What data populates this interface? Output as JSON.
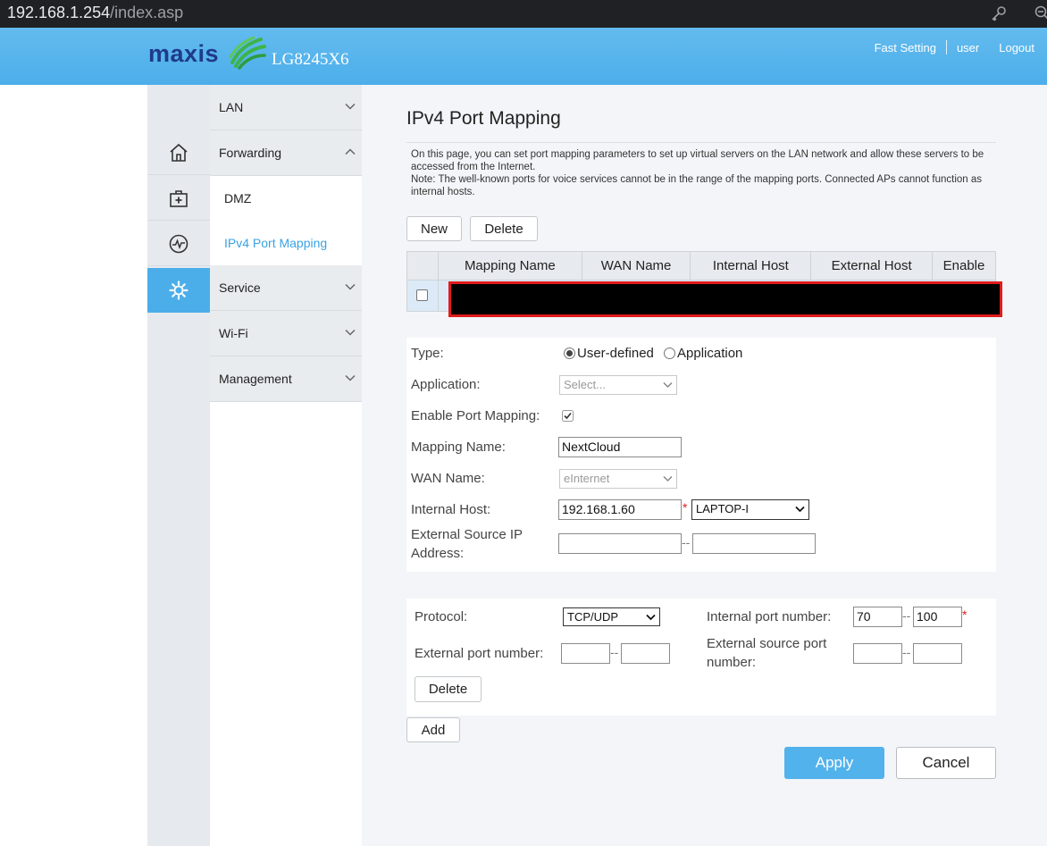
{
  "browser": {
    "url_host": "192.168.1.254",
    "url_path": "/index.asp"
  },
  "header": {
    "logo": "maxis",
    "model": "LG8245X6",
    "links": [
      "Fast Setting",
      "user",
      "Logout"
    ]
  },
  "rail": {
    "icons": [
      "home-icon",
      "firstaid-icon",
      "pulse-icon",
      "gear-icon"
    ],
    "active": "gear-icon"
  },
  "menu": {
    "lan": "LAN",
    "forwarding": "Forwarding",
    "sub_dmz": "DMZ",
    "sub_ipv4": "IPv4 Port Mapping",
    "service": "Service",
    "wifi": "Wi-Fi",
    "management": "Management"
  },
  "page": {
    "title": "IPv4 Port Mapping",
    "desc1": "On this page, you can set port mapping parameters to set up virtual servers on the LAN network and allow these servers to be accessed from the Internet.",
    "desc2": "Note: The well-known ports for voice services cannot be in the range of the mapping ports. Connected APs cannot function as internal hosts.",
    "new_btn": "New",
    "delete_btn": "Delete"
  },
  "table": {
    "headers": [
      "Mapping Name",
      "WAN Name",
      "Internal Host",
      "External Host",
      "Enable"
    ]
  },
  "form": {
    "type_label": "Type:",
    "type_user": "User-defined",
    "type_app": "Application",
    "app_label": "Application:",
    "app_value": "Select...",
    "enable_label": "Enable Port Mapping:",
    "name_label": "Mapping Name:",
    "name_value": "NextCloud",
    "wan_label": "WAN Name:",
    "wan_value": "eInternet",
    "host_label": "Internal Host:",
    "host_value": "192.168.1.60",
    "host_select": "LAPTOP-I",
    "ext_ip_label1": "External Source IP",
    "ext_ip_label2": "Address:"
  },
  "ports": {
    "protocol_label": "Protocol:",
    "protocol_value": "TCP/UDP",
    "int_port_label": "Internal port number:",
    "int_port_from": "70",
    "int_port_to": "100",
    "ext_port_label": "External port number:",
    "ext_src_label1": "External source port",
    "ext_src_label2": "number:",
    "delete_btn": "Delete",
    "add_btn": "Add"
  },
  "actions": {
    "apply": "Apply",
    "cancel": "Cancel"
  },
  "colors": {
    "accent": "#4baee9",
    "header": "#58b6ec",
    "logo": "#1f3a8a",
    "redact_border": "#e01b1b"
  }
}
